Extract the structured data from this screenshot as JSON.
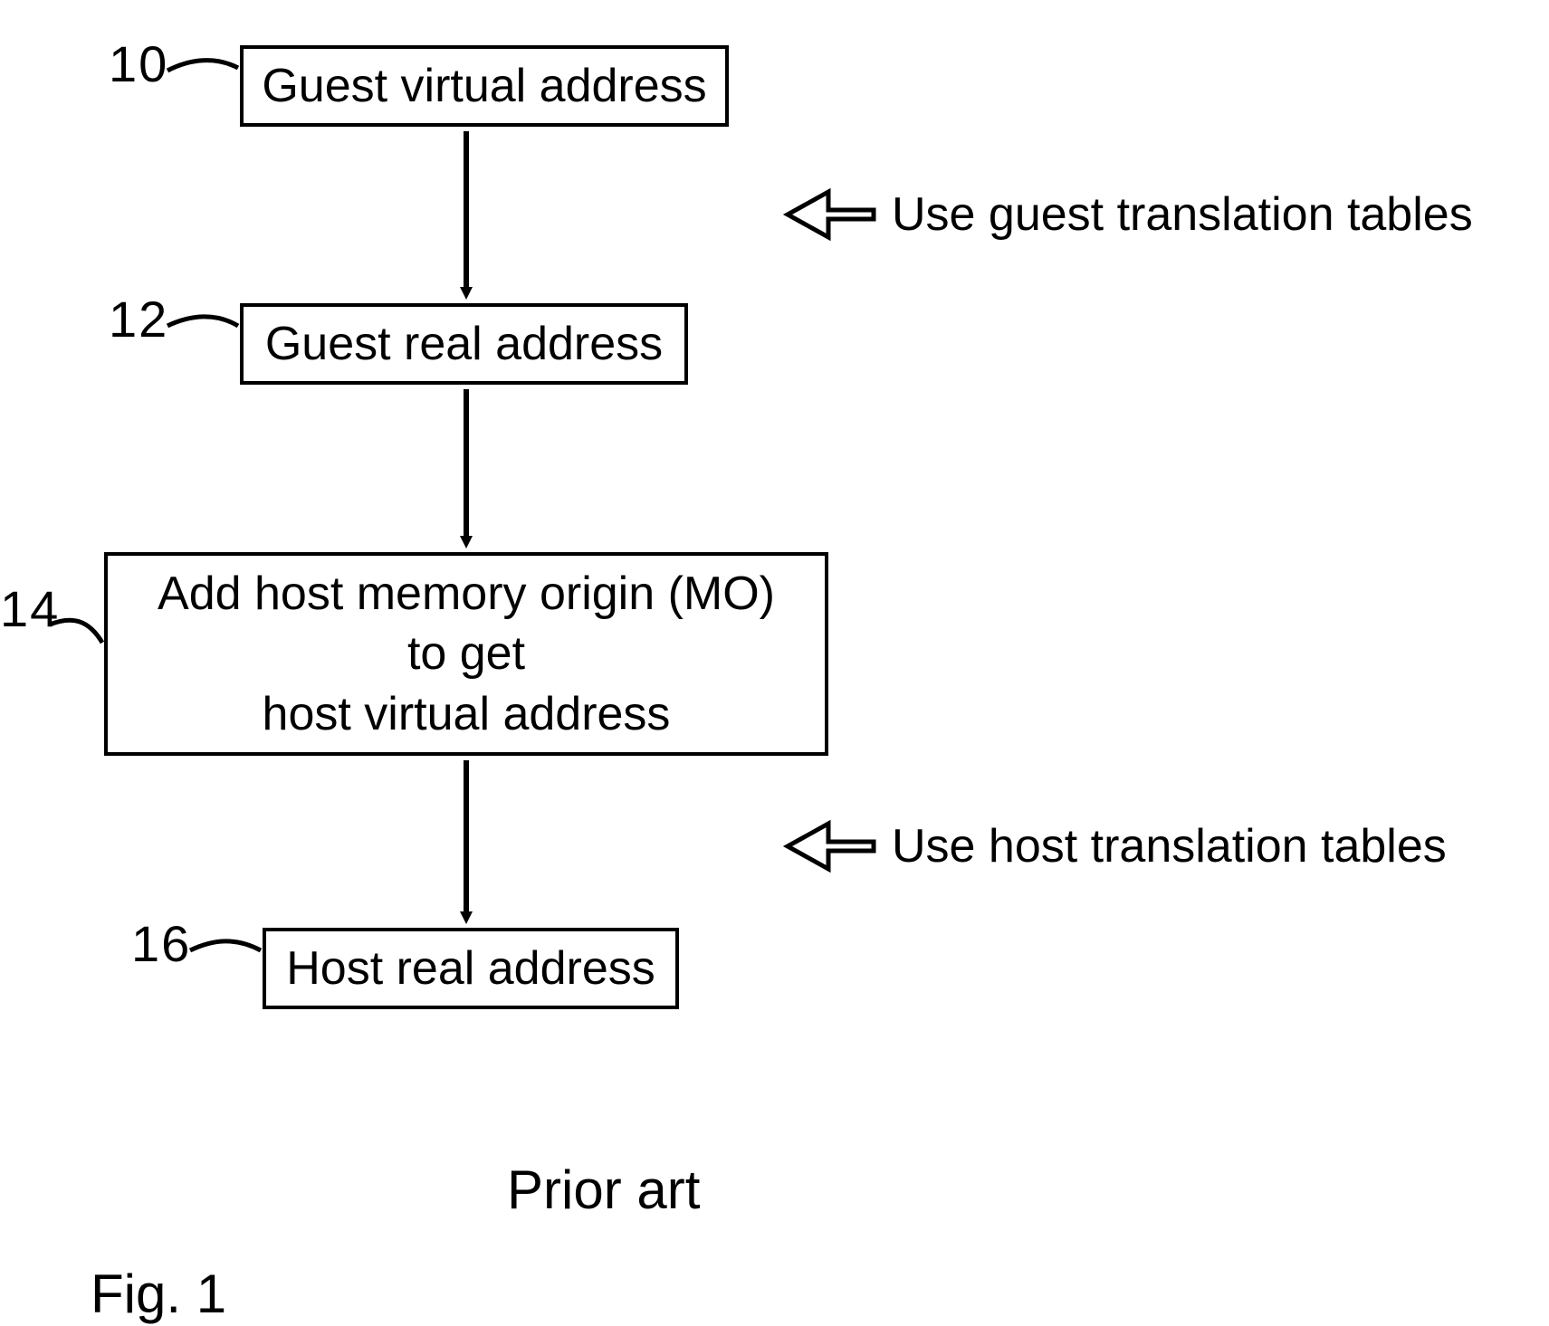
{
  "boxes": {
    "b10": {
      "num": "10",
      "text": "Guest virtual address"
    },
    "b12": {
      "num": "12",
      "text": "Guest real address"
    },
    "b14": {
      "num": "14",
      "text": "Add host memory origin (MO)\nto get\nhost virtual address"
    },
    "b16": {
      "num": "16",
      "text": "Host real address"
    }
  },
  "annotations": {
    "a1": "Use guest translation tables",
    "a2": "Use host translation tables"
  },
  "caption": "Prior art",
  "figure": "Fig. 1"
}
